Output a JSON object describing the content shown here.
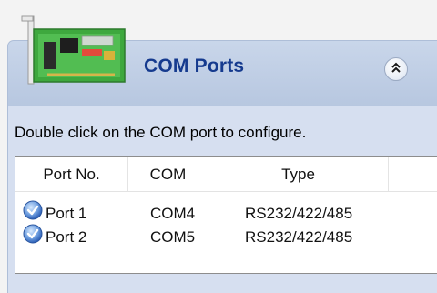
{
  "header": {
    "title": "COM Ports",
    "icon": "pci-card-icon",
    "collapse_icon": "double-chevron-up-icon"
  },
  "hint": "Double click on the COM port to configure.",
  "columns": [
    "Port No.",
    "COM",
    "Type",
    ""
  ],
  "rows": [
    {
      "port": "Port 1",
      "com": "COM4",
      "type": "RS232/422/485",
      "icon": "checkmark-circle-icon"
    },
    {
      "port": "Port 2",
      "com": "COM5",
      "type": "RS232/422/485",
      "icon": "checkmark-circle-icon"
    }
  ],
  "colors": {
    "title": "#153a8e",
    "header_bg": "#c9d6ea",
    "content_bg": "#d6dff0"
  }
}
